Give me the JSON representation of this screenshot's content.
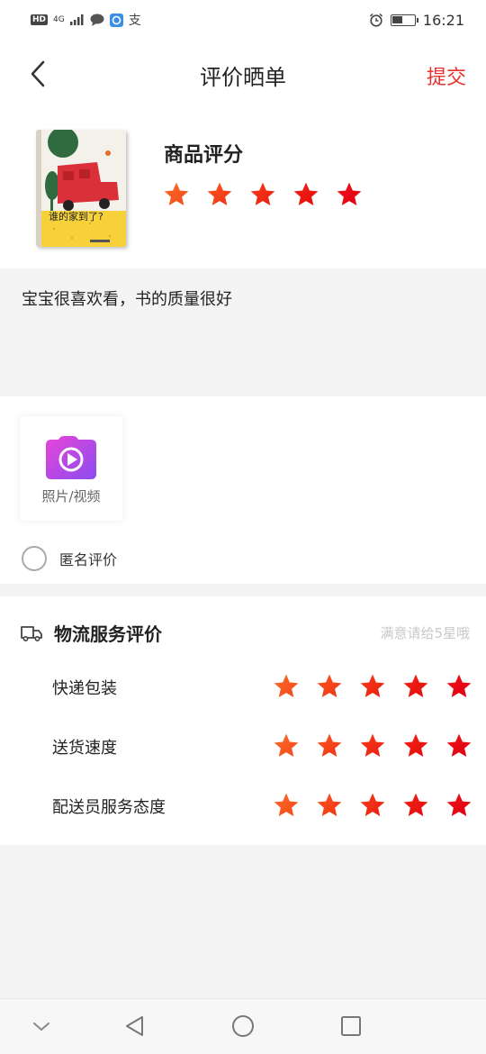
{
  "status_bar": {
    "time": "16:21",
    "hd": "HD",
    "network": "4G",
    "alipay": "支"
  },
  "nav": {
    "title": "评价晒单",
    "submit": "提交"
  },
  "product": {
    "rating_title": "商品评分",
    "rating": 5,
    "cover_title": "谁的家到了?"
  },
  "comment": {
    "text": "宝宝很喜欢看，书的质量很好"
  },
  "media": {
    "upload_label": "照片/视频",
    "anonymous_label": "匿名评价"
  },
  "logistics": {
    "title": "物流服务评价",
    "hint": "满意请给5星哦",
    "rows": [
      {
        "label": "快递包装",
        "rating": 5
      },
      {
        "label": "送货速度",
        "rating": 5
      },
      {
        "label": "配送员服务态度",
        "rating": 5
      }
    ]
  },
  "colors": {
    "accent": "#e8322d",
    "star_start": "#ff5a1f",
    "star_end": "#e8001c"
  }
}
